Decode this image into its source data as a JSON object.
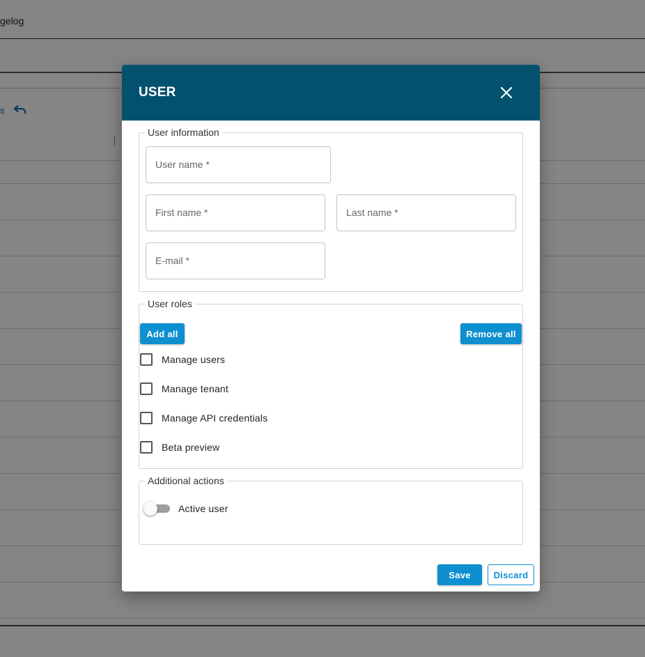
{
  "background": {
    "topbar_text": "gelog",
    "link_fragment": "s"
  },
  "modal": {
    "title": "USER",
    "user_information": {
      "legend": "User information",
      "user_name_label": "User name *",
      "first_name_label": "First name *",
      "last_name_label": "Last name *",
      "email_label": "E-mail *"
    },
    "user_roles": {
      "legend": "User roles",
      "add_all_label": "Add all",
      "remove_all_label": "Remove all",
      "roles": [
        {
          "label": "Manage users",
          "checked": false
        },
        {
          "label": "Manage tenant",
          "checked": false
        },
        {
          "label": "Manage API credentials",
          "checked": false
        },
        {
          "label": "Beta preview",
          "checked": false
        }
      ]
    },
    "additional_actions": {
      "legend": "Additional actions",
      "active_user_label": "Active user",
      "active_user_on": false
    },
    "footer": {
      "save_label": "Save",
      "discard_label": "Discard"
    }
  },
  "colors": {
    "header": "#02526f",
    "primary": "#0e8fd0"
  }
}
